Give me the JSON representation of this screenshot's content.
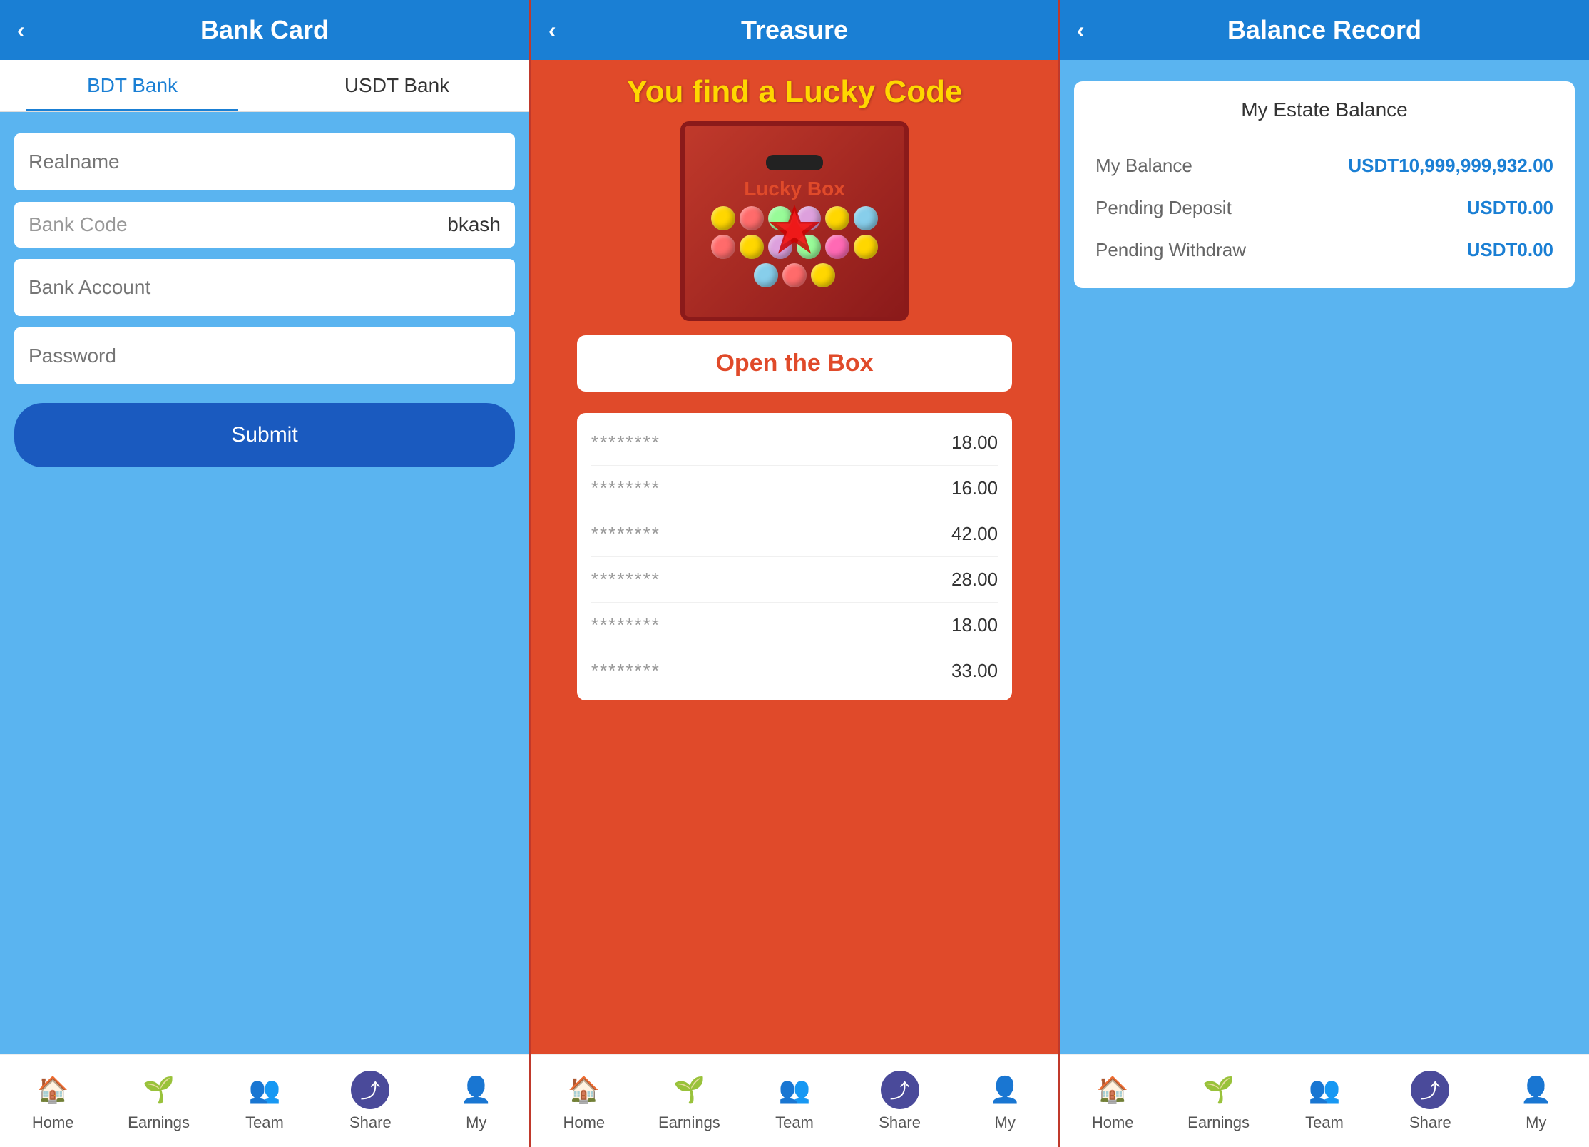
{
  "panel1": {
    "header": {
      "title": "Bank Card",
      "back_label": "‹"
    },
    "tabs": [
      {
        "label": "BDT Bank",
        "active": true
      },
      {
        "label": "USDT Bank",
        "active": false
      }
    ],
    "form": {
      "realname_placeholder": "Realname",
      "bank_code_label": "Bank Code",
      "bank_code_value": "bkash",
      "bank_account_placeholder": "Bank Account",
      "password_placeholder": "Password",
      "submit_label": "Submit"
    },
    "nav": [
      {
        "label": "Home",
        "icon": "home"
      },
      {
        "label": "Earnings",
        "icon": "earnings"
      },
      {
        "label": "Team",
        "icon": "team"
      },
      {
        "label": "Share",
        "icon": "share"
      },
      {
        "label": "My",
        "icon": "my"
      }
    ]
  },
  "panel2": {
    "header": {
      "title": "Treasure",
      "back_label": "‹"
    },
    "lucky_title": "You find a Lucky Code",
    "lucky_box_label": "Lucky Box",
    "open_btn_label": "Open the Box",
    "records": [
      {
        "stars": "********",
        "amount": "18.00"
      },
      {
        "stars": "********",
        "amount": "16.00"
      },
      {
        "stars": "********",
        "amount": "42.00"
      },
      {
        "stars": "********",
        "amount": "28.00"
      },
      {
        "stars": "********",
        "amount": "18.00"
      },
      {
        "stars": "********",
        "amount": "33.00"
      }
    ],
    "nav": [
      {
        "label": "Home",
        "icon": "home"
      },
      {
        "label": "Earnings",
        "icon": "earnings"
      },
      {
        "label": "Team",
        "icon": "team"
      },
      {
        "label": "Share",
        "icon": "share"
      },
      {
        "label": "My",
        "icon": "my"
      }
    ]
  },
  "panel3": {
    "header": {
      "title": "Balance Record",
      "back_label": "‹"
    },
    "estate": {
      "title": "My Estate Balance",
      "rows": [
        {
          "label": "My Balance",
          "value": "USDT10,999,999,932.00"
        },
        {
          "label": "Pending Deposit",
          "value": "USDT0.00"
        },
        {
          "label": "Pending Withdraw",
          "value": "USDT0.00"
        }
      ]
    },
    "nav": [
      {
        "label": "Home",
        "icon": "home"
      },
      {
        "label": "Earnings",
        "icon": "earnings"
      },
      {
        "label": "Team",
        "icon": "team"
      },
      {
        "label": "Share",
        "icon": "share"
      },
      {
        "label": "My",
        "icon": "my"
      }
    ]
  },
  "balls": [
    {
      "color": "#FFD700"
    },
    {
      "color": "#FF6B6B"
    },
    {
      "color": "#98FB98"
    },
    {
      "color": "#DDA0DD"
    },
    {
      "color": "#FFD700"
    },
    {
      "color": "#87CEEB"
    },
    {
      "color": "#FF6B6B"
    },
    {
      "color": "#FFD700"
    },
    {
      "color": "#DDA0DD"
    },
    {
      "color": "#98FB98"
    },
    {
      "color": "#FF69B4"
    },
    {
      "color": "#FFD700"
    },
    {
      "color": "#87CEEB"
    },
    {
      "color": "#FF6B6B"
    },
    {
      "color": "#FFD700"
    }
  ]
}
